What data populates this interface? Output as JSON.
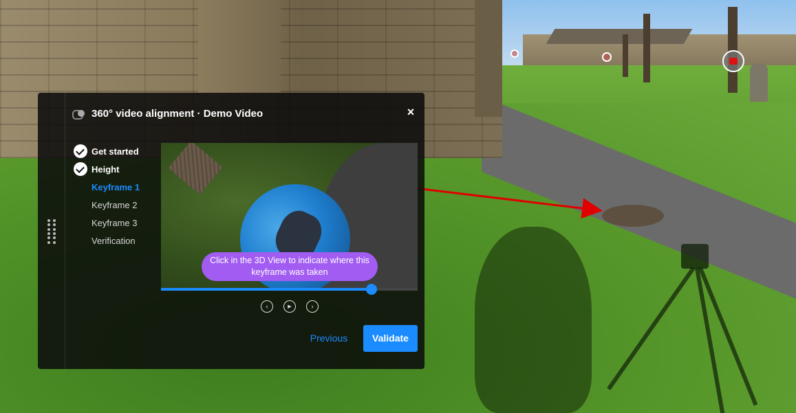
{
  "dialog": {
    "title": "360° video alignment · Demo Video",
    "close_glyph": "×",
    "steps": [
      {
        "label": "Get started",
        "state": "done"
      },
      {
        "label": "Height",
        "state": "done"
      },
      {
        "label": "Keyframe 1",
        "state": "active"
      },
      {
        "label": "Keyframe 2",
        "state": "pending"
      },
      {
        "label": "Keyframe 3",
        "state": "pending"
      },
      {
        "label": "Verification",
        "state": "pending"
      }
    ],
    "tooltip": "Click in the 3D View to indicate where this keyframe was taken",
    "timeline_progress": 0.82,
    "controls": {
      "prev_glyph": "‹",
      "play_glyph": "▶",
      "next_glyph": "›"
    },
    "previous_label": "Previous",
    "validate_label": "Validate"
  },
  "colors": {
    "accent": "#1a8cff",
    "tooltip": "#a25cf2",
    "arrow": "#e00000",
    "dialog_bg": "rgba(10,10,10,0.86)"
  },
  "icons": {
    "toggle": "toggle-icon",
    "close": "close-icon",
    "check": "check-icon",
    "drag": "drag-handle-icon",
    "prev": "chevron-left-icon",
    "play": "play-icon",
    "next": "chevron-right-icon"
  }
}
